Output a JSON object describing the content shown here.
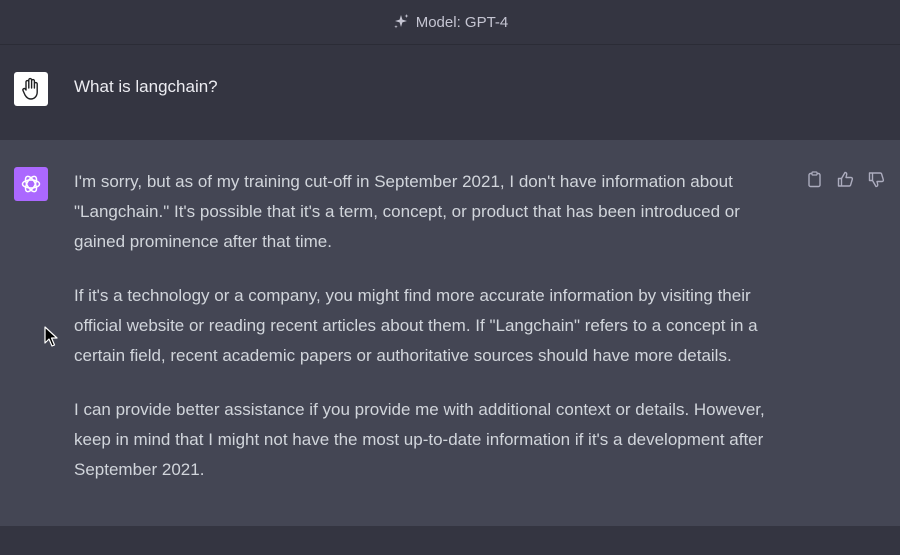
{
  "header": {
    "model_label": "Model: GPT-4",
    "icon": "sparkle-icon"
  },
  "conversation": {
    "user_message": "What is langchain?",
    "user_avatar_icon": "hand-icon",
    "assistant_avatar_icon": "openai-logo-icon",
    "assistant_paragraphs": [
      "I'm sorry, but as of my training cut-off in September 2021, I don't have information about \"Langchain.\" It's possible that it's a term, concept, or product that has been introduced or gained prominence after that time.",
      "If it's a technology or a company, you might find more accurate information by visiting their official website or reading recent articles about them. If \"Langchain\" refers to a concept in a certain field, recent academic papers or authoritative sources should have more details.",
      "I can provide better assistance if you provide me with additional context or details. However, keep in mind that I might not have the most up-to-date information if it's a development after September 2021."
    ],
    "actions": [
      "copy-icon",
      "thumbs-up-icon",
      "thumbs-down-icon"
    ]
  },
  "colors": {
    "background": "#343541",
    "assistant_background": "#444654",
    "assistant_avatar": "#ab68ff"
  }
}
